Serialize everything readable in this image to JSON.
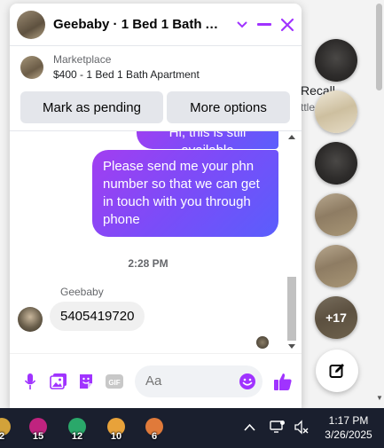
{
  "background": {
    "partial_label_1": "Recall",
    "partial_label_2": "ttle"
  },
  "chat": {
    "title": "Geebaby · 1 Bed 1 Bath Apartment",
    "listing": {
      "category": "Marketplace",
      "price_title": "$400 - 1 Bed 1 Bath Apartment"
    },
    "actions": {
      "mark_pending": "Mark as pending",
      "more_options": "More options"
    },
    "messages": {
      "outgoing_partial": "Hi, this is still available",
      "outgoing_main": "Please send me your phn number so that we can get in touch with you through phone",
      "timestamp": "2:28 PM",
      "sender_name": "Geebaby",
      "incoming": "5405419720"
    },
    "composer": {
      "placeholder": "Aa"
    },
    "icons": {
      "minimize": "minimize-icon",
      "close": "close-icon",
      "chevron": "chevron-down-icon",
      "mic": "microphone-icon",
      "image": "image-icon",
      "sticker": "sticker-icon",
      "gif": "gif-icon",
      "emoji": "emoji-icon",
      "like": "thumbs-up-icon"
    },
    "accent": "#a033ff"
  },
  "chat_heads": {
    "more_count": "+17"
  },
  "taskbar": {
    "apps": [
      "2",
      "15",
      "12",
      "10",
      "6"
    ],
    "time": "1:17 PM",
    "date": "3/26/2025"
  }
}
